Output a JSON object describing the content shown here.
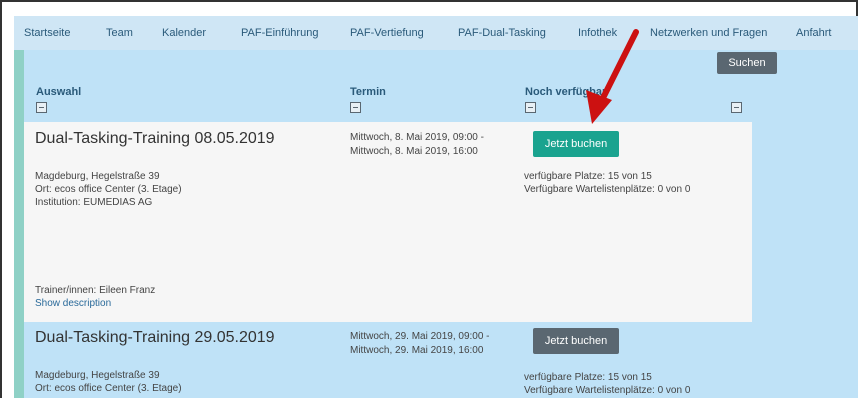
{
  "nav": {
    "items": [
      {
        "label": "Startseite"
      },
      {
        "label": "Team"
      },
      {
        "label": "Kalender"
      },
      {
        "label": "PAF-Einführung"
      },
      {
        "label": "PAF-Vertiefung"
      },
      {
        "label": "PAF-Dual-Tasking"
      },
      {
        "label": "Infothek"
      },
      {
        "label": "Netzwerken und Fragen"
      },
      {
        "label": "Anfahrt"
      }
    ]
  },
  "search": {
    "label": "Suchen"
  },
  "columns": {
    "auswahl": "Auswahl",
    "termin": "Termin",
    "verfuegbar": "Noch verfügbar"
  },
  "events": [
    {
      "title": "Dual-Tasking-Training 08.05.2019",
      "date_start": "Mittwoch, 8. Mai 2019, 09:00 -",
      "date_end": "Mittwoch, 8. Mai 2019, 16:00",
      "address": "Magdeburg, Hegelstraße 39",
      "location": "Ort: ecos office Center (3. Etage)",
      "institution": "Institution: EUMEDIAS AG",
      "trainer": "Trainer/innen: Eileen Franz",
      "description_link": "Show description",
      "book_label": "Jetzt buchen",
      "places": "verfügbare Platze: 15 von 15",
      "waitlist": "Verfügbare Wartelistenplätze: 0 von 0"
    },
    {
      "title": "Dual-Tasking-Training 29.05.2019",
      "date_start": "Mittwoch, 29. Mai 2019, 09:00 -",
      "date_end": "Mittwoch, 29. Mai 2019, 16:00",
      "address": "Magdeburg, Hegelstraße 39",
      "location": "Ort: ecos office Center (3. Etage)",
      "book_label": "Jetzt buchen",
      "places": "verfügbare Platze: 15 von 15",
      "waitlist": "Verfügbare Wartelistenplätze: 0 von 0"
    }
  ],
  "colors": {
    "accent": "#1aa38f",
    "nav_bg": "#cfe6f5",
    "content_bg": "#bfe2f7",
    "annotation_arrow": "#cc1111"
  }
}
